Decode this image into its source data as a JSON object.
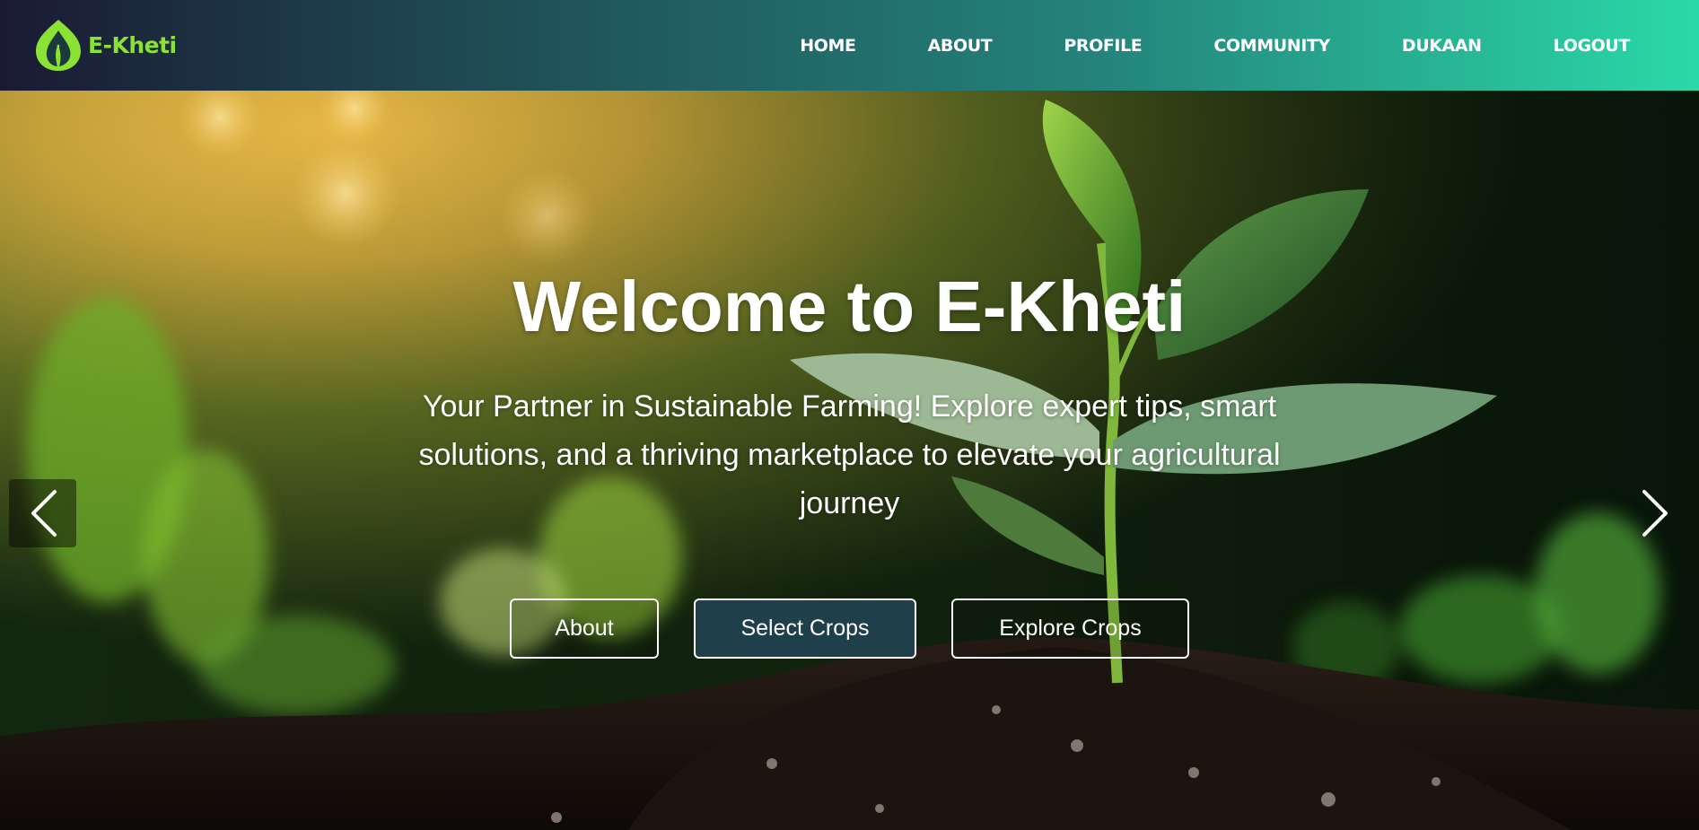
{
  "brand": {
    "name": "E-Kheti",
    "logo_icon": "leaf-flame-logo",
    "logo_color": "#8ae234"
  },
  "nav": {
    "items": [
      {
        "label": "HOME"
      },
      {
        "label": "ABOUT"
      },
      {
        "label": "PROFILE"
      },
      {
        "label": "COMMUNITY"
      },
      {
        "label": "DUKAAN"
      },
      {
        "label": "LOGOUT"
      }
    ],
    "gradient_start": "#1a1a33",
    "gradient_end": "#2ad9a8"
  },
  "hero": {
    "title": "Welcome to E-Kheti",
    "subtitle": "Your Partner in Sustainable Farming! Explore expert tips, smart solutions, and a thriving marketplace to elevate your agricultural journey",
    "buttons": [
      {
        "label": "About"
      },
      {
        "label": "Select Crops"
      },
      {
        "label": "Explore Crops"
      }
    ],
    "background": "seedling-sprouting-from-soil-photo",
    "prev_icon": "chevron-left-icon",
    "next_icon": "chevron-right-icon"
  }
}
